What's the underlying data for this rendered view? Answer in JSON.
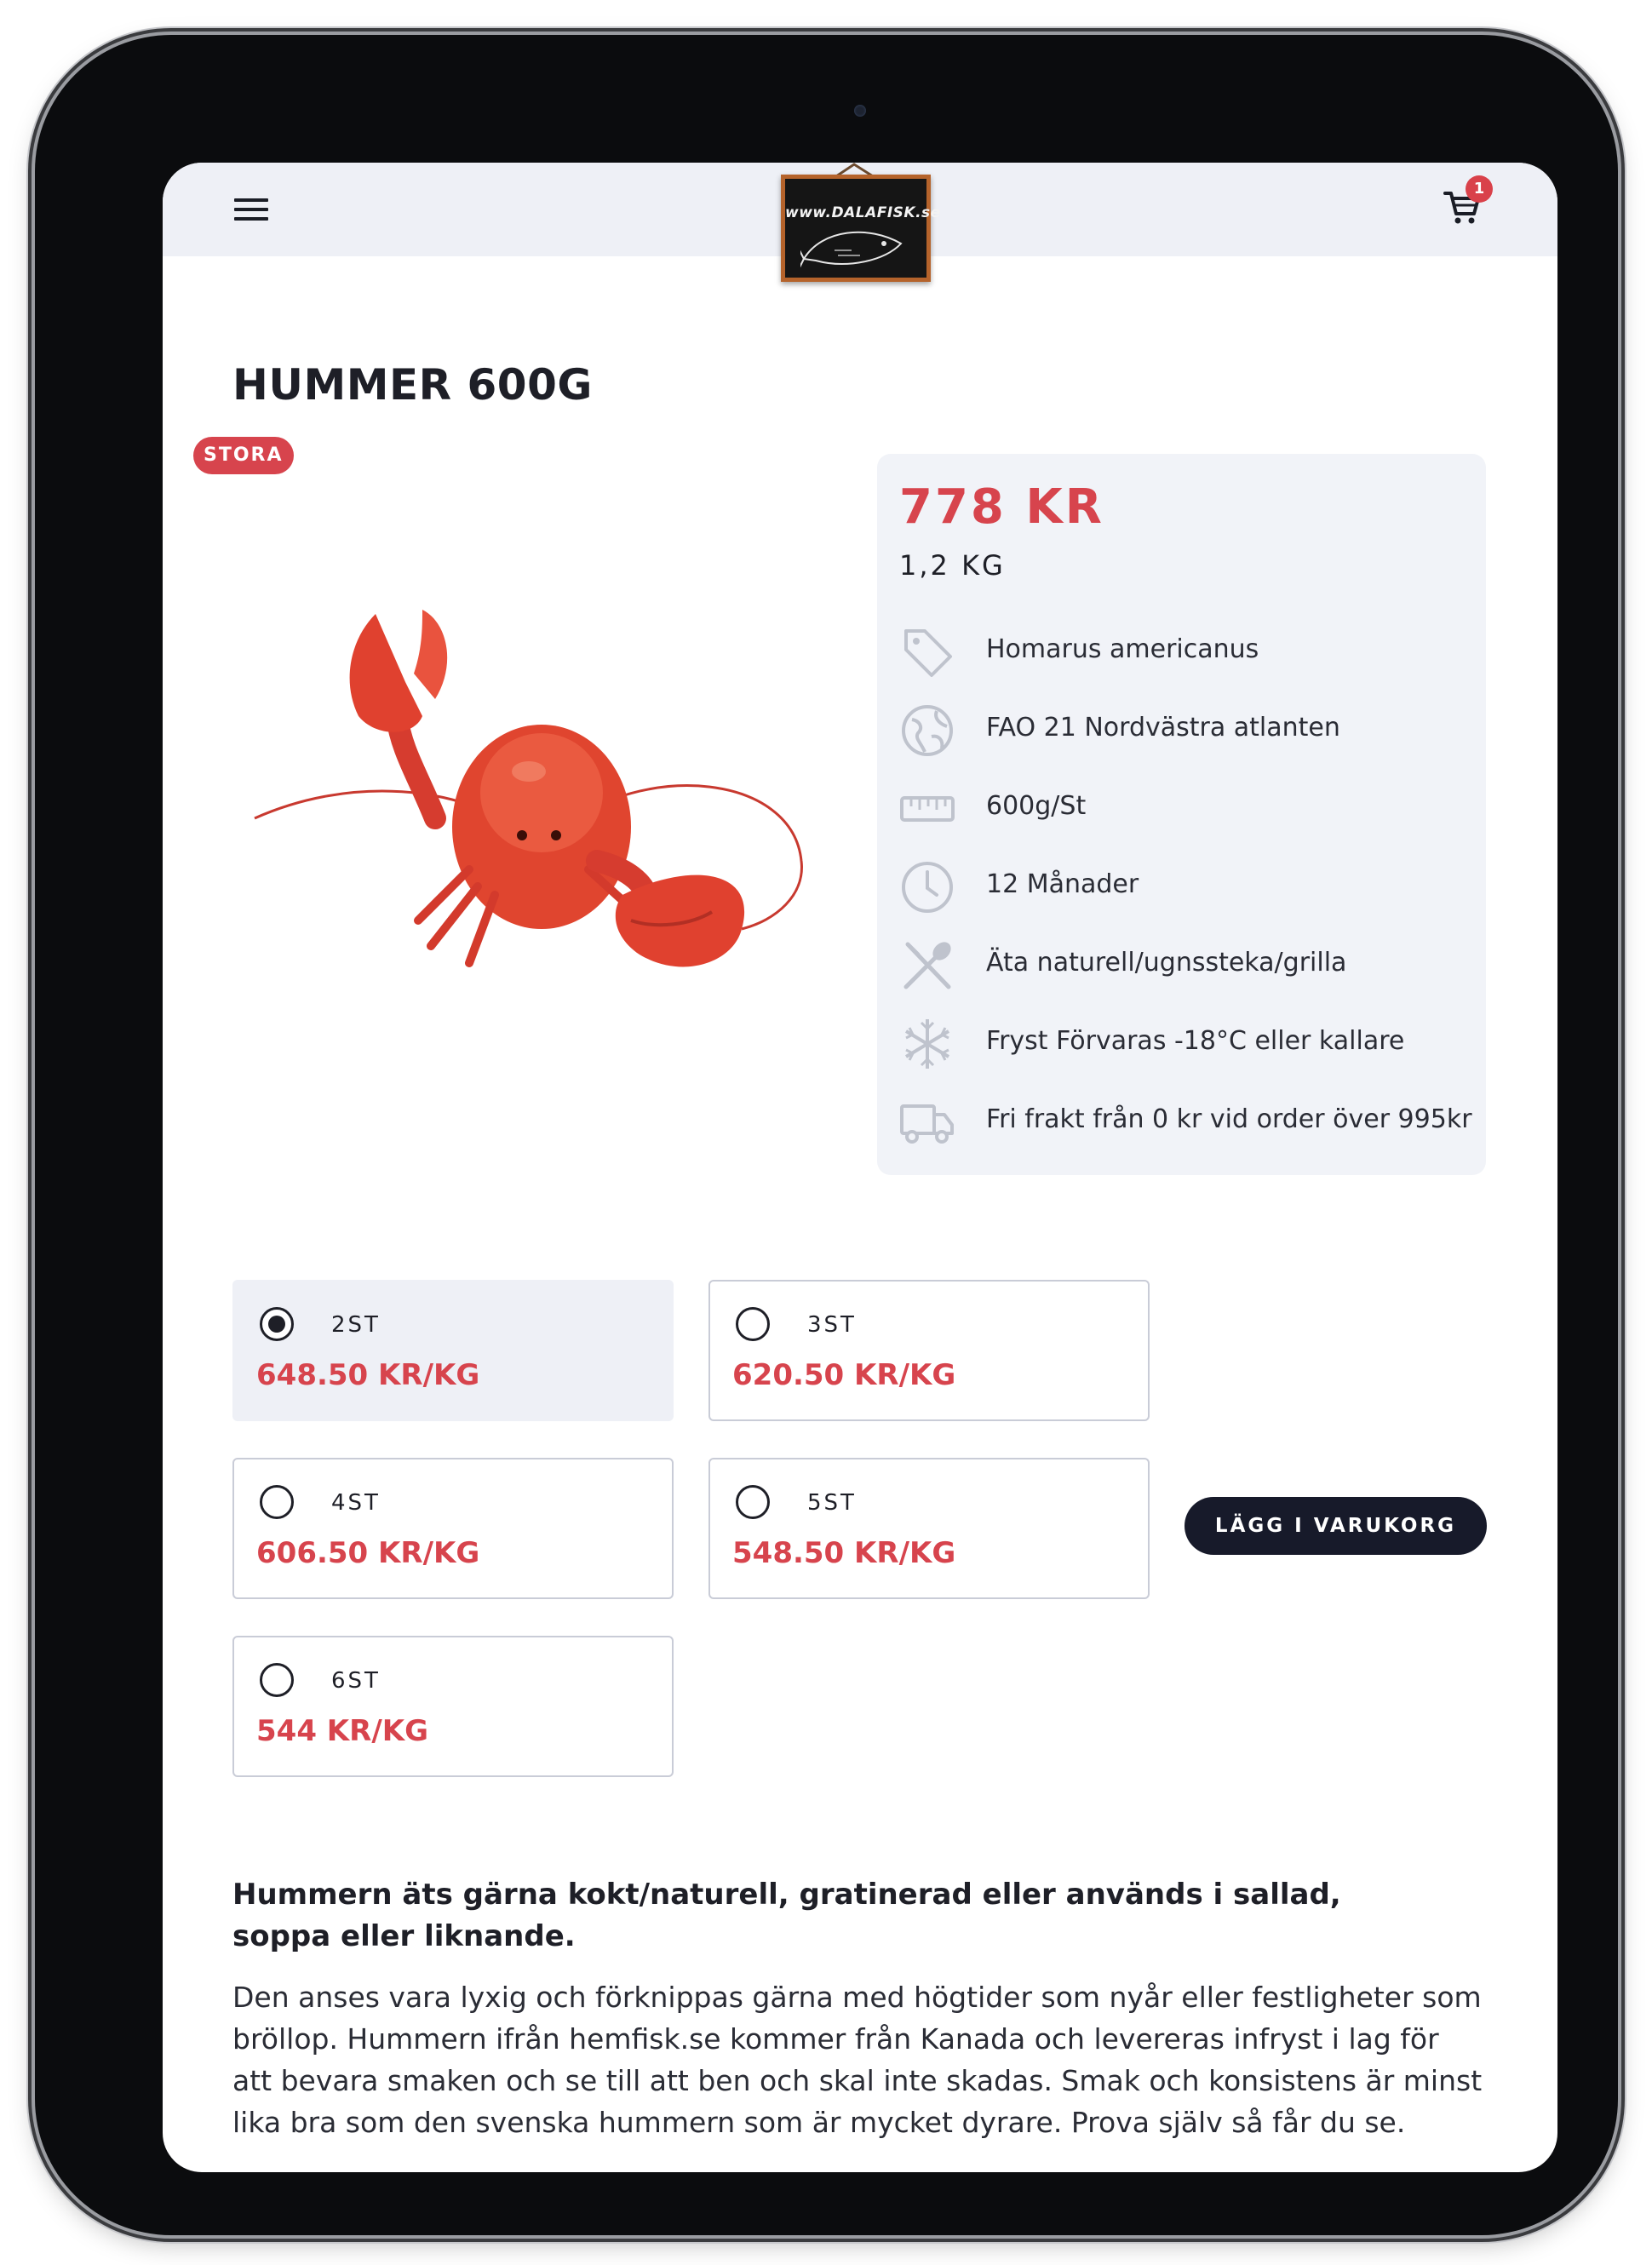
{
  "header": {
    "logo_text": "www.DALAFISK.se",
    "cart_count": "1"
  },
  "product": {
    "title": "HUMMER 600G",
    "badge": "STORA",
    "price": "778 KR",
    "weight": "1,2 KG",
    "attributes": [
      {
        "icon": "tag-icon",
        "text": "Homarus americanus"
      },
      {
        "icon": "globe-icon",
        "text": "FAO 21 Nordvästra atlanten"
      },
      {
        "icon": "ruler-icon",
        "text": "600g/St"
      },
      {
        "icon": "clock-icon",
        "text": "12 Månader"
      },
      {
        "icon": "utensils-icon",
        "text": "Äta naturell/ugnssteka/grilla"
      },
      {
        "icon": "snowflake-icon",
        "text": "Fryst Förvaras -18°C eller kallare"
      },
      {
        "icon": "truck-icon",
        "text": "Fri frakt från 0 kr vid order över 995kr"
      }
    ]
  },
  "options": [
    {
      "qty": "2ST",
      "price_per_kg": "648.50 KR/KG",
      "selected": true
    },
    {
      "qty": "3ST",
      "price_per_kg": "620.50 KR/KG",
      "selected": false
    },
    {
      "qty": "4ST",
      "price_per_kg": "606.50 KR/KG",
      "selected": false
    },
    {
      "qty": "5ST",
      "price_per_kg": "548.50 KR/KG",
      "selected": false
    },
    {
      "qty": "6ST",
      "price_per_kg": "544 KR/KG",
      "selected": false
    }
  ],
  "add_to_cart_label": "LÄGG I VARUKORG",
  "description": {
    "lead": "Hummern äts gärna kokt/naturell, gratinerad eller används i sallad, soppa eller liknande.",
    "body": "Den anses vara lyxig och förknippas gärna med högtider som nyår eller festligheter som bröllop. Hummern ifrån hemfisk.se kommer från Kanada och levereras infryst i lag för att bevara smaken och se till att ben och skal inte skadas. Smak och konsistens är minst lika bra som den svenska hummern som är mycket dyrare. Prova själv så får du se."
  },
  "colors": {
    "accent_red": "#d7444d",
    "header_bg": "#eef0f6",
    "panel_bg": "#f1f3f8",
    "button_dark": "#171a2a"
  }
}
